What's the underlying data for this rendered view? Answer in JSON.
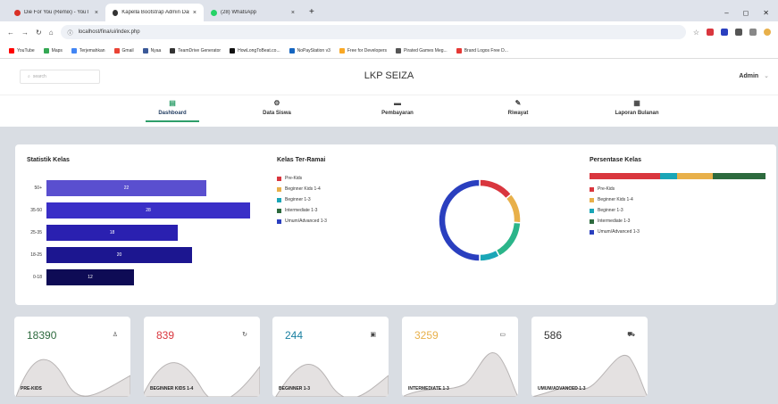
{
  "browser": {
    "tabs": [
      {
        "title": "Die For You (Remix) - YouT",
        "color": "#d93025"
      },
      {
        "title": "Kapella Bootstrap Admin Dashb",
        "color": "#333333"
      },
      {
        "title": "(28) WhatsApp",
        "color": "#25d366"
      }
    ],
    "url": "localhost/fina/ui/index.php",
    "bookmarks": [
      {
        "label": "YouTube",
        "color": "#ff0000"
      },
      {
        "label": "Maps",
        "color": "#34a853"
      },
      {
        "label": "Terjemahkan",
        "color": "#4285f4"
      },
      {
        "label": "Gmail",
        "color": "#ea4335"
      },
      {
        "label": "Nyaa",
        "color": "#3b5998"
      },
      {
        "label": "TeamDrive Generator",
        "color": "#333333"
      },
      {
        "label": "HowLongToBeat.co...",
        "color": "#111111"
      },
      {
        "label": "NoPayStation v3",
        "color": "#1565c0"
      },
      {
        "label": "Free for Developers",
        "color": "#f9a825"
      },
      {
        "label": "Pirated Games Meg...",
        "color": "#555555"
      },
      {
        "label": "Brand Logos Free D...",
        "color": "#e53935"
      }
    ]
  },
  "header": {
    "search_placeholder": "search",
    "brand": "LKP SEIZA",
    "user": "Admin"
  },
  "nav": [
    {
      "label": "Dashboard",
      "icon": "dashboard-icon",
      "glyph": "▤",
      "active": true
    },
    {
      "label": "Data Siswa",
      "icon": "students-icon",
      "glyph": "⚙",
      "active": false
    },
    {
      "label": "Pembayaran",
      "icon": "payment-icon",
      "glyph": "▬",
      "active": false
    },
    {
      "label": "Riwayat",
      "icon": "history-icon",
      "glyph": "✎",
      "active": false
    },
    {
      "label": "Laporan Bulanan",
      "icon": "report-icon",
      "glyph": "▦",
      "active": false
    }
  ],
  "statistik": {
    "title": "Statistik Kelas",
    "rows": [
      {
        "label": "50+",
        "value": 22,
        "color": "#5a4fcf"
      },
      {
        "label": "35-50",
        "value": 28,
        "color": "#3a2fc7"
      },
      {
        "label": "25-35",
        "value": 18,
        "color": "#2a20b0"
      },
      {
        "label": "18-25",
        "value": 20,
        "color": "#1c1690"
      },
      {
        "label": "0-18",
        "value": 12,
        "color": "#0e0b55"
      }
    ]
  },
  "kelas_ramai": {
    "title": "Kelas Ter-Ramai",
    "legend": [
      {
        "label": "Pre-Kids",
        "color": "#d9363e"
      },
      {
        "label": "Beginner Kids 1-4",
        "color": "#e8b04a"
      },
      {
        "label": "Beginner 1-3",
        "color": "#1aa6b7"
      },
      {
        "label": "Intermediate 1-3",
        "color": "#2d6a3e"
      },
      {
        "label": "Umum/Advanced 1-3",
        "color": "#2a3fbf"
      }
    ]
  },
  "chart_data": {
    "type": "pie",
    "categories": [
      "Pre-Kids",
      "Beginner Kids 1-4",
      "Beginner 1-3",
      "Intermediate 1-3",
      "Umum/Advanced 1-3"
    ],
    "values": [
      14,
      12,
      16,
      8,
      50
    ],
    "colors": [
      "#d9363e",
      "#e8b04a",
      "#2bb58a",
      "#1aa6b7",
      "#2a3fbf"
    ]
  },
  "persentase": {
    "title": "Persentase Kelas",
    "segments": [
      {
        "value": 40,
        "color": "#d9363e"
      },
      {
        "value": 10,
        "color": "#1aa6b7"
      },
      {
        "value": 20,
        "color": "#e8b04a"
      },
      {
        "value": 30,
        "color": "#2d6a3e"
      }
    ],
    "legend": [
      {
        "label": "Pre-Kids",
        "color": "#d9363e"
      },
      {
        "label": "Beginner Kids 1-4",
        "color": "#e8b04a"
      },
      {
        "label": "Beginner 1-3",
        "color": "#1aa6b7"
      },
      {
        "label": "Intermediate 1-3",
        "color": "#2d6a3e"
      },
      {
        "label": "Umum/Advanced 1-3",
        "color": "#2a3fbf"
      }
    ]
  },
  "stats": [
    {
      "value": "18390",
      "label": "PRE-KIDS",
      "color": "#2d6a3e",
      "icon": "user-icon",
      "glyph": "♙"
    },
    {
      "value": "839",
      "label": "BEGINNER KIDS 1-4",
      "color": "#d9363e",
      "icon": "refresh-icon",
      "glyph": "↻"
    },
    {
      "value": "244",
      "label": "BEGINNER 1-3",
      "color": "#1a7fa0",
      "icon": "document-icon",
      "glyph": "▣"
    },
    {
      "value": "3259",
      "label": "INTERMEDIATE 1-3",
      "color": "#e8b04a",
      "icon": "folder-icon",
      "glyph": "▭"
    },
    {
      "value": "586",
      "label": "UMUM/ADVANCED 1-3",
      "color": "#333333",
      "icon": "cart-icon",
      "glyph": "⛟"
    }
  ]
}
